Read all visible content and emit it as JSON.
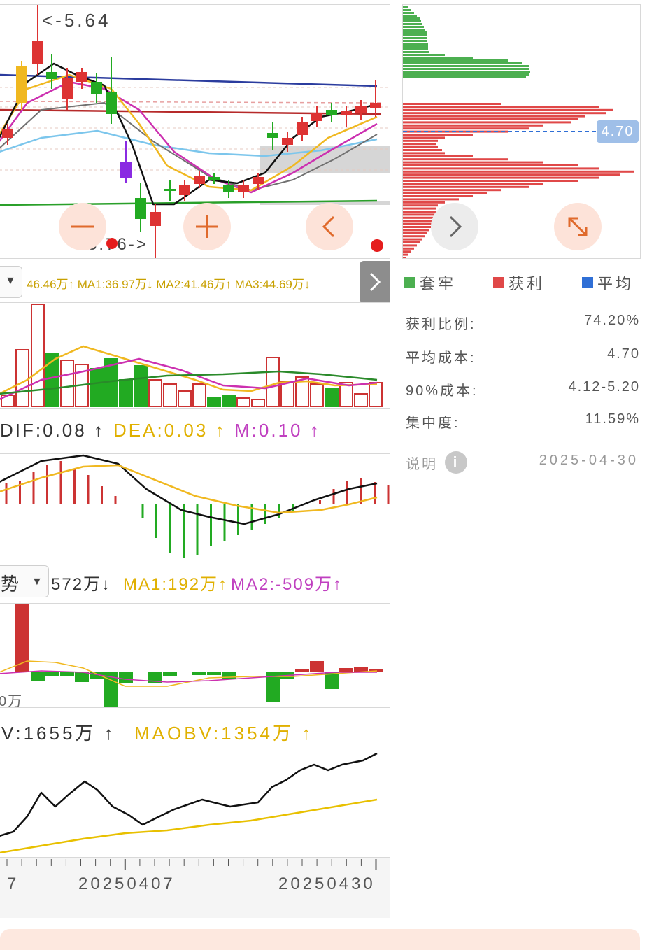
{
  "kline": {
    "high_label": "<-5.64",
    "low_label": "3.76->"
  },
  "volume": {
    "header": "46.46万↑ MA1:36.97万↓ MA2:41.46万↑ MA3:44.69万↓"
  },
  "macd": {
    "dif": "DIF:0.08 ↑",
    "dea": "DEA:0.03 ↑",
    "m": "M:0.10 ↑"
  },
  "flow": {
    "selector_label": "势",
    "value": "572万↓",
    "ma1": "MA1:192万↑",
    "ma2": "MA2:-509万↑",
    "axis_label": "0万"
  },
  "obv": {
    "obv": "V:1655万 ↑",
    "maobv": "MAOBV:1354万 ↑"
  },
  "date_axis": {
    "labels": [
      "7",
      "20250407",
      "20250430"
    ]
  },
  "chips": {
    "avg_price_tag": "4.70",
    "legend": [
      "套牢",
      "获利",
      "平均"
    ],
    "colors": {
      "trapped": "#4caf50",
      "profit": "#e04848",
      "average": "#2f6fd6"
    },
    "stats": [
      {
        "label": "获利比例:",
        "value": "74.20%"
      },
      {
        "label": "平均成本:",
        "value": "4.70"
      },
      {
        "label": "90%成本:",
        "value": "4.12-5.20"
      },
      {
        "label": "集中度:",
        "value": "11.59%"
      }
    ],
    "note_label": "说明",
    "date": "2025-04-30"
  },
  "icons": {
    "zoom_out": "minus-icon",
    "zoom_in": "plus-icon",
    "back": "chevron-left-icon",
    "forward": "chevron-right-icon",
    "expand": "expand-icon",
    "info": "info-icon",
    "dropdown": "caret-down-icon"
  }
}
